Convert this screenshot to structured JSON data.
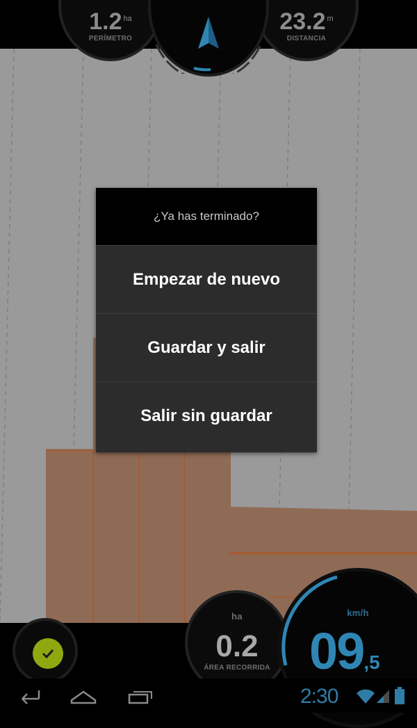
{
  "top_gauges": {
    "perimeter": {
      "value": "1.2",
      "unit": "ha",
      "label": "PERÍMETRO"
    },
    "distance": {
      "value": "23.2",
      "unit": "m",
      "label": "DISTANCIA"
    }
  },
  "dialog": {
    "title": "¿Ya has terminado?",
    "options": [
      "Empezar de nuevo",
      "Guardar y salir",
      "Salir sin guardar"
    ]
  },
  "bottom_gauges": {
    "area": {
      "unit": "ha",
      "value": "0.2",
      "label": "ÁREA RECORRIDA"
    },
    "speed": {
      "unit": "km/h",
      "value": "09",
      "decimal": ",5"
    }
  },
  "status_bar": {
    "time": "2:30"
  },
  "icons": {
    "compass": "navigation-arrow-icon",
    "confirm": "check-icon",
    "nav": [
      "back-icon",
      "home-icon",
      "recent-apps-icon"
    ],
    "status": [
      "wifi-icon",
      "signal-icon",
      "battery-icon"
    ]
  },
  "colors": {
    "accent": "#2f86b4",
    "confirm_green": "#8fa80f",
    "field_orange": "#c2683a"
  }
}
